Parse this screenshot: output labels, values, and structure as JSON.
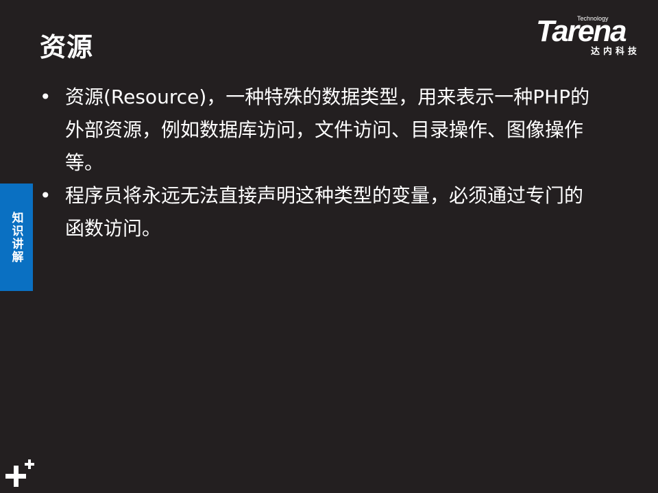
{
  "title": "资源",
  "logo": {
    "brand": "Tarena",
    "tagline": "Technology",
    "cn": "达内科技"
  },
  "side_tab": {
    "label": "知识讲解",
    "color": "#0a70c2"
  },
  "bullets": [
    "资源(Resource)，一种特殊的数据类型，用来表示一种PHP的外部资源，例如数据库访问，文件访问、目录操作、图像操作等。",
    "程序员将永远无法直接声明这种类型的变量，必须通过专门的函数访问。"
  ],
  "background": "#231f20"
}
